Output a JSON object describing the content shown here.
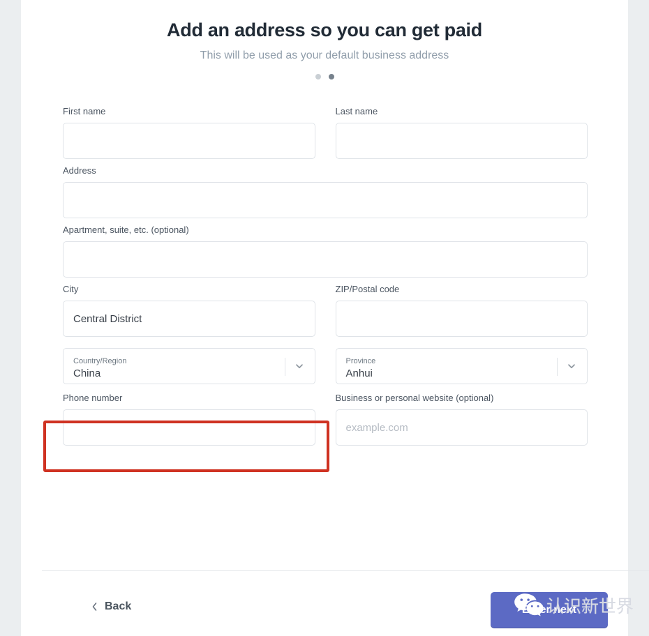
{
  "header": {
    "title": "Add an address so you can get paid",
    "subtitle": "This will be used as your default business address",
    "step_dots": 2,
    "active_dot": 2
  },
  "form": {
    "first_name": {
      "label": "First name",
      "value": "",
      "placeholder": ""
    },
    "last_name": {
      "label": "Last name",
      "value": "",
      "placeholder": ""
    },
    "address": {
      "label": "Address",
      "value": "",
      "placeholder": ""
    },
    "apartment": {
      "label": "Apartment, suite, etc. (optional)",
      "value": "",
      "placeholder": ""
    },
    "city": {
      "label": "City",
      "value": "Central District",
      "placeholder": ""
    },
    "zip": {
      "label": "ZIP/Postal code",
      "value": "",
      "placeholder": ""
    },
    "country": {
      "label": "Country/Region",
      "value": "China"
    },
    "province": {
      "label": "Province",
      "value": "Anhui"
    },
    "phone": {
      "label": "Phone number",
      "value": "",
      "placeholder": ""
    },
    "website": {
      "label": "Business or personal website (optional)",
      "value": "",
      "placeholder": "example.com"
    }
  },
  "footer": {
    "back_label": "Back",
    "submit_label": "Enter next"
  },
  "watermark": {
    "text": "认识新世界",
    "logo": "wechat-logo"
  },
  "colors": {
    "primary_button": "#5c6ac4",
    "highlight_border": "#cf3222",
    "page_background": "#ebeef0",
    "card_background": "#ffffff",
    "title_text": "#212b36",
    "subtitle_text": "#919eab"
  }
}
